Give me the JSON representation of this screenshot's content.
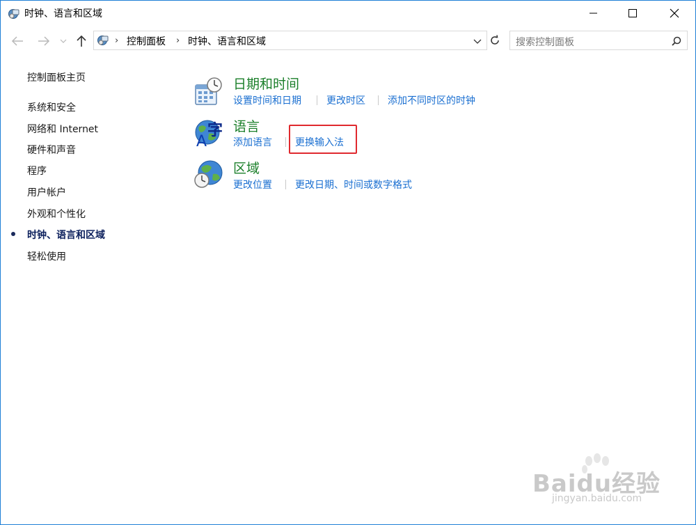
{
  "window": {
    "title": "时钟、语言和区域",
    "icon": "control-panel-icon"
  },
  "navigation": {
    "breadcrumb": [
      "控制面板",
      "时钟、语言和区域"
    ],
    "search_placeholder": "搜索控制面板"
  },
  "sidebar": {
    "items": [
      {
        "label": "控制面板主页"
      },
      {
        "label": "系统和安全"
      },
      {
        "label": "网络和 Internet"
      },
      {
        "label": "硬件和声音"
      },
      {
        "label": "程序"
      },
      {
        "label": "用户帐户"
      },
      {
        "label": "外观和个性化"
      },
      {
        "label": "时钟、语言和区域",
        "current": true
      },
      {
        "label": "轻松使用"
      }
    ]
  },
  "categories": [
    {
      "title": "日期和时间",
      "icon": "calendar-clock-icon",
      "links": [
        "设置时间和日期",
        "更改时区",
        "添加不同时区的时钟"
      ]
    },
    {
      "title": "语言",
      "icon": "globe-language-icon",
      "links": [
        "添加语言",
        "更换输入法"
      ]
    },
    {
      "title": "区域",
      "icon": "globe-clock-icon",
      "links": [
        "更改位置",
        "更改日期、时间或数字格式"
      ]
    }
  ],
  "watermark": {
    "text": "Baidu经验",
    "subtext": "jingyan.baidu.com"
  },
  "colors": {
    "category_title": "#1b7f2a",
    "link": "#1a6fd1",
    "highlight_box": "#e0292e",
    "window_border": "#1e7fd6"
  }
}
